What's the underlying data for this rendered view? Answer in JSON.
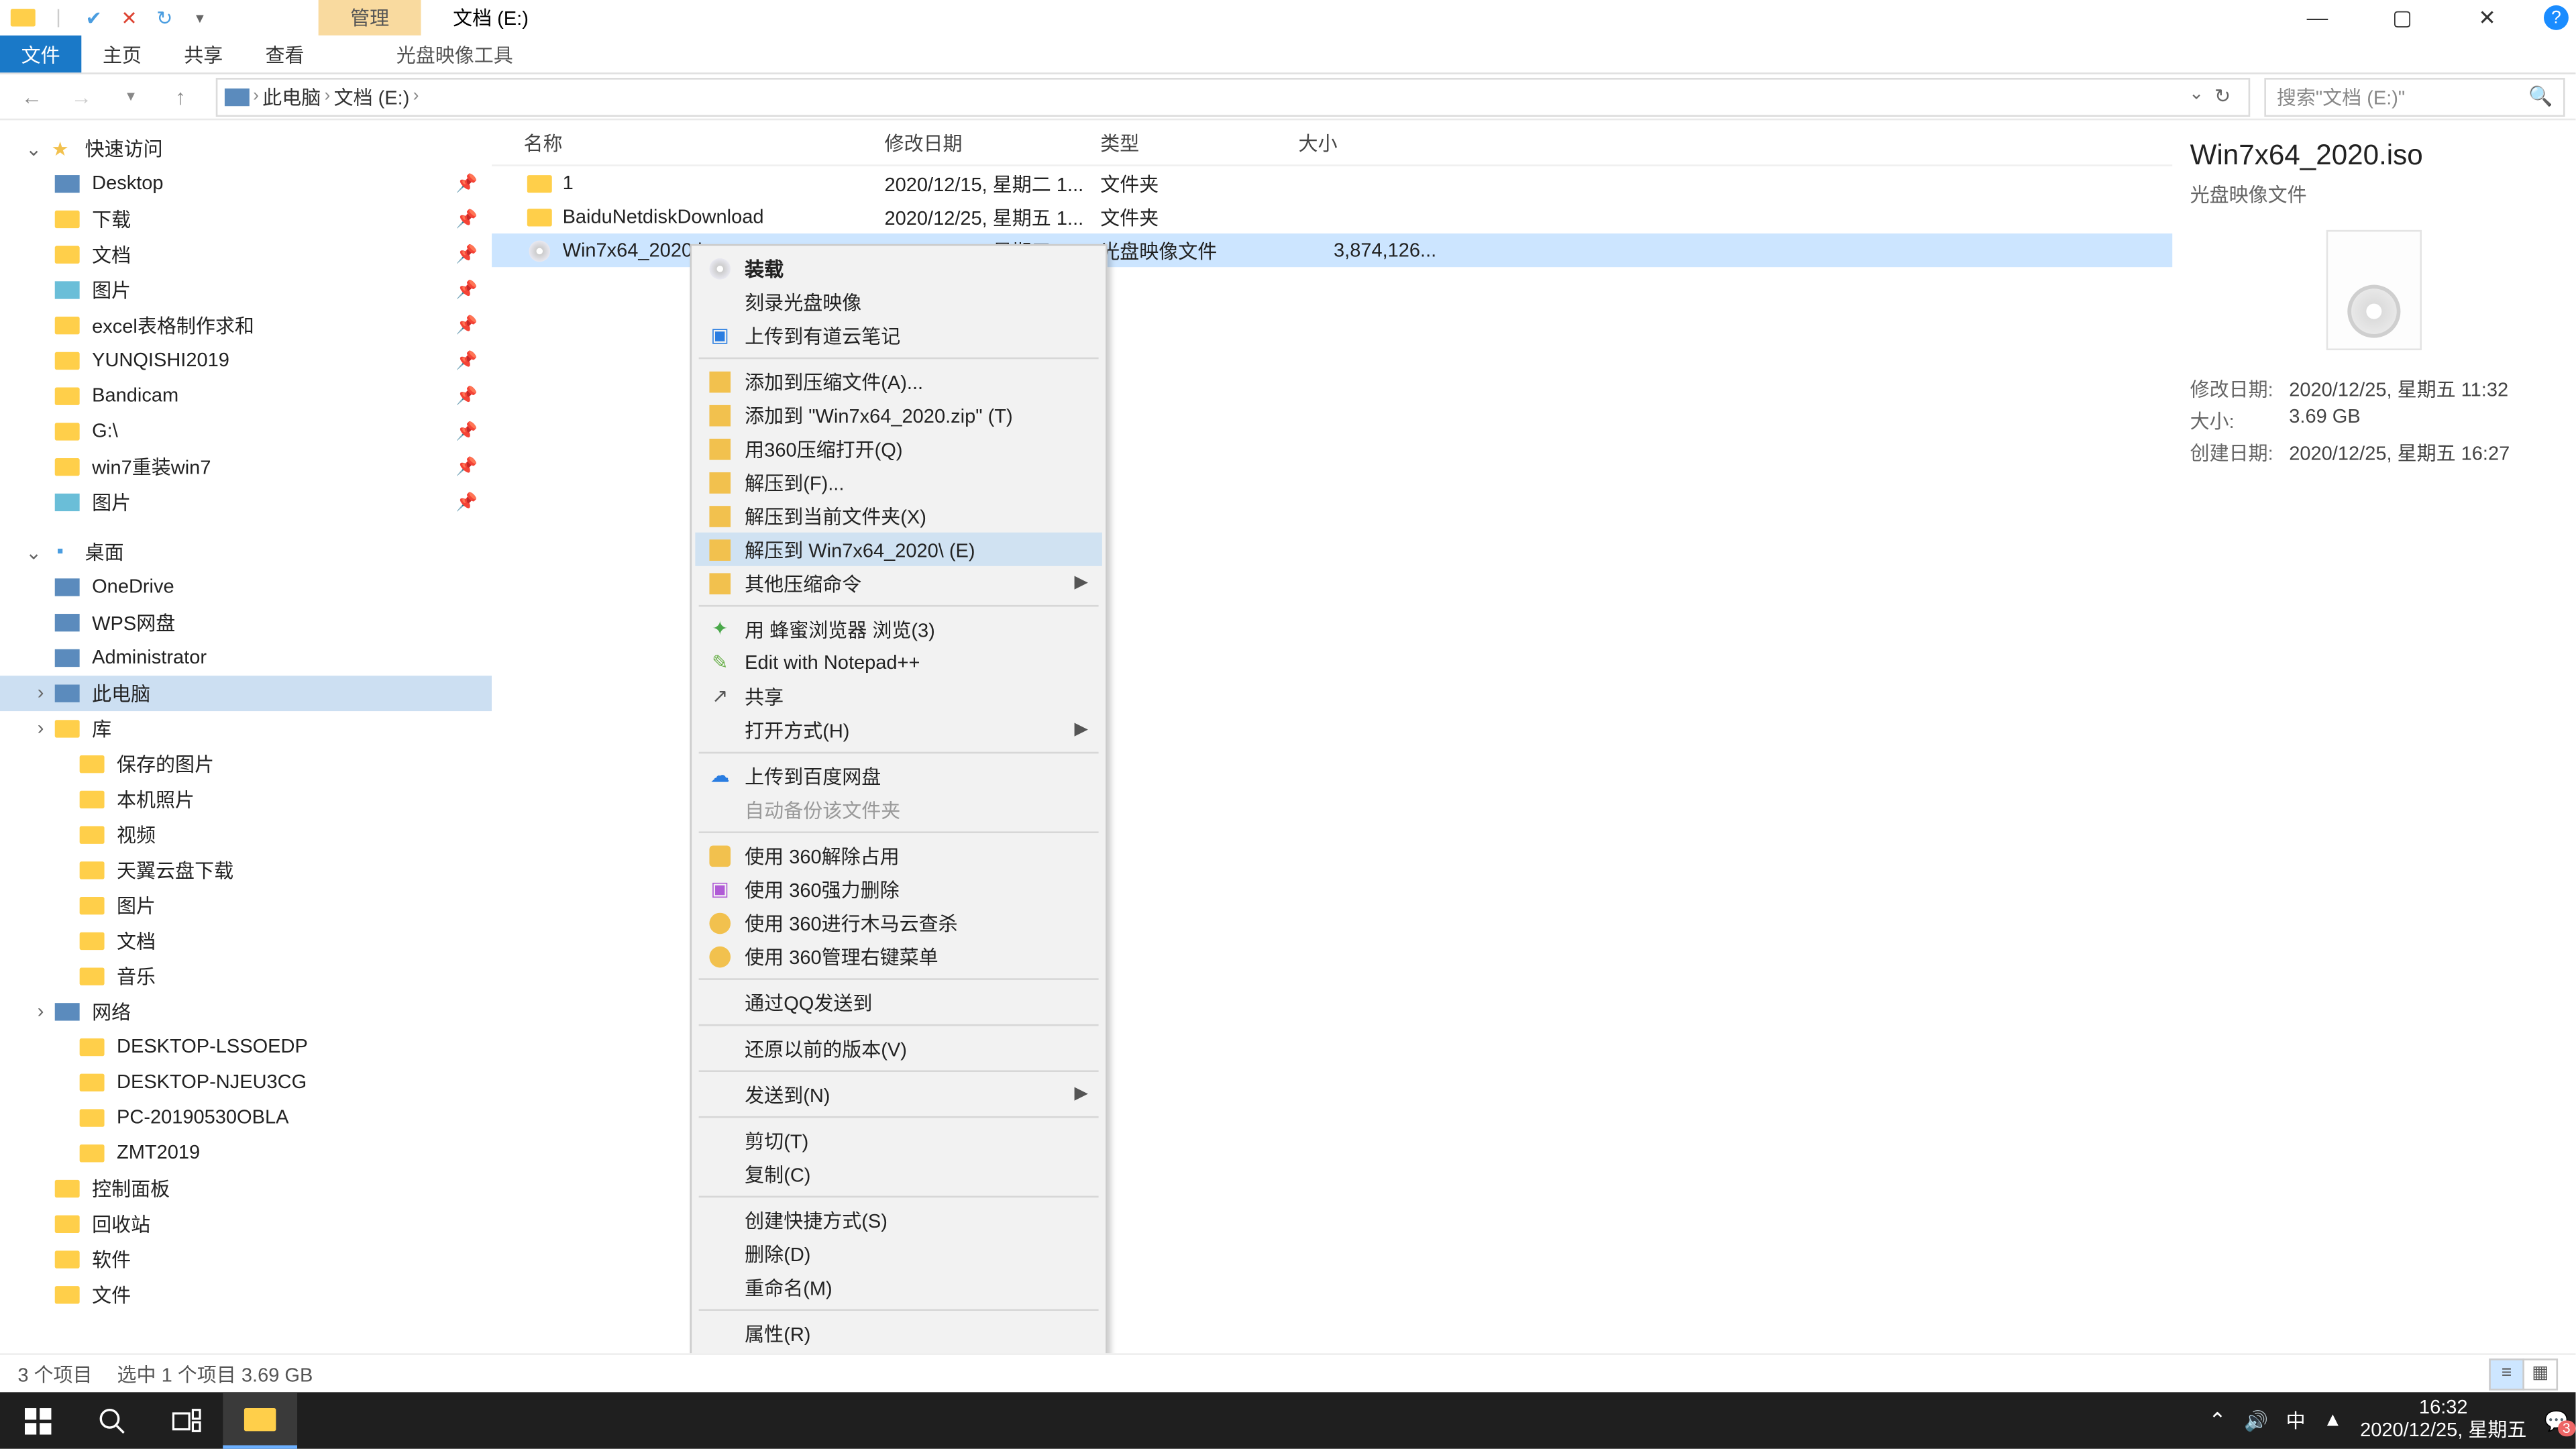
{
  "title_ctx": "管理",
  "title_location": "文档 (E:)",
  "ribbon": {
    "file": "文件",
    "home": "主页",
    "share": "共享",
    "view": "查看",
    "tool": "光盘映像工具"
  },
  "crumbs": {
    "root": "此电脑",
    "loc": "文档 (E:)"
  },
  "search_placeholder": "搜索\"文档 (E:)\"",
  "columns": {
    "name": "名称",
    "date": "修改日期",
    "type": "类型",
    "size": "大小"
  },
  "nav": {
    "quick": "快速访问",
    "items_quick": [
      "Desktop",
      "下载",
      "文档",
      "图片",
      "excel表格制作求和",
      "YUNQISHI2019",
      "Bandicam",
      "G:\\",
      "win7重装win7",
      "图片"
    ],
    "desktop": "桌面",
    "items_desktop": [
      "OneDrive",
      "WPS网盘",
      "Administrator",
      "此电脑",
      "库",
      "保存的图片",
      "本机照片",
      "视频",
      "天翼云盘下载",
      "图片",
      "文档",
      "音乐",
      "网络",
      "DESKTOP-LSSOEDP",
      "DESKTOP-NJEU3CG",
      "PC-20190530OBLA",
      "ZMT2019",
      "控制面板",
      "回收站",
      "软件",
      "文件"
    ]
  },
  "files": [
    {
      "name": "1",
      "date": "2020/12/15, 星期二 1...",
      "type": "文件夹",
      "size": ""
    },
    {
      "name": "BaiduNetdiskDownload",
      "date": "2020/12/25, 星期五 1...",
      "type": "文件夹",
      "size": ""
    },
    {
      "name": "Win7x64_2020.iso",
      "date": "2020/12/25, 星期五 1...",
      "type": "光盘映像文件",
      "size": "3,874,126..."
    }
  ],
  "ctx": [
    "装载",
    "刻录光盘映像",
    "上传到有道云笔记",
    "添加到压缩文件(A)...",
    "添加到 \"Win7x64_2020.zip\" (T)",
    "用360压缩打开(Q)",
    "解压到(F)...",
    "解压到当前文件夹(X)",
    "解压到 Win7x64_2020\\ (E)",
    "其他压缩命令",
    "用 蜂蜜浏览器 浏览(3)",
    "Edit with Notepad++",
    "共享",
    "打开方式(H)",
    "上传到百度网盘",
    "自动备份该文件夹",
    "使用 360解除占用",
    "使用 360强力删除",
    "使用 360进行木马云查杀",
    "使用 360管理右键菜单",
    "通过QQ发送到",
    "还原以前的版本(V)",
    "发送到(N)",
    "剪切(T)",
    "复制(C)",
    "创建快捷方式(S)",
    "删除(D)",
    "重命名(M)",
    "属性(R)"
  ],
  "details": {
    "title": "Win7x64_2020.iso",
    "sub": "光盘映像文件",
    "meta": [
      {
        "k": "修改日期:",
        "v": "2020/12/25, 星期五 11:32"
      },
      {
        "k": "大小:",
        "v": "3.69 GB"
      },
      {
        "k": "创建日期:",
        "v": "2020/12/25, 星期五 16:27"
      }
    ]
  },
  "status": {
    "a": "3 个项目",
    "b": "选中 1 个项目  3.69 GB"
  },
  "tray": {
    "ime": "中",
    "time": "16:32",
    "date": "2020/12/25, 星期五",
    "badge": "3"
  }
}
